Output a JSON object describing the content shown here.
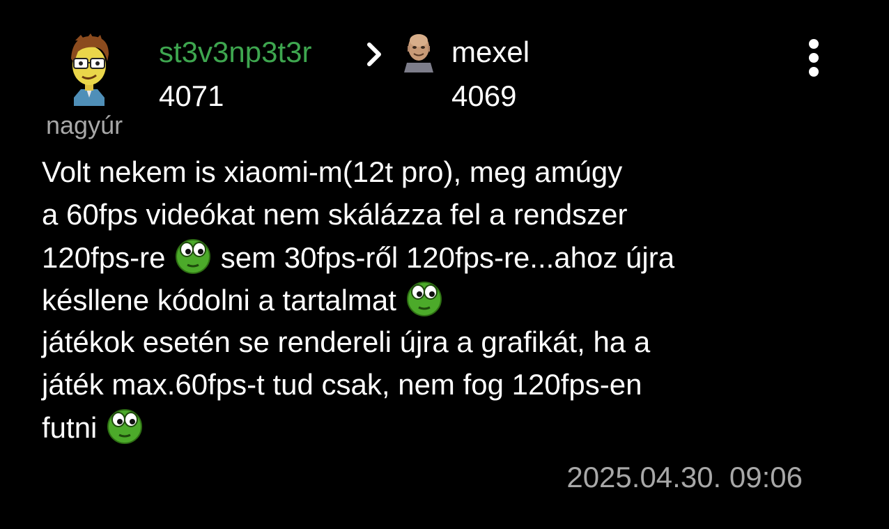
{
  "post": {
    "author": {
      "name": "st3v3np3t3r",
      "count": "4071",
      "rank": "nagyúr",
      "name_color": "#3ea64f"
    },
    "reply_to": {
      "name": "mexel",
      "count": "4069"
    },
    "arrow_icon": "chevron-right-icon",
    "menu_icon": "more-vertical-icon",
    "body": {
      "line1": "Volt nekem is xiaomi-m(12t pro), meg amúgy",
      "line2": "a 60fps videókat nem skálázza fel a rendszer",
      "line3a": "120fps-re ",
      "line3b": " sem 30fps-ről 120fps-re...ahoz újra",
      "line4a": "késllene kódolni a tartalmat ",
      "line5": "játékok esetén se rendereli újra a grafikát, ha a",
      "line6": "játék max.60fps-t tud csak, nem fog 120fps-en",
      "line7a": "futni "
    },
    "emoticon": "eyes-smiley-icon",
    "timestamp": "2025.04.30. 09:06"
  }
}
